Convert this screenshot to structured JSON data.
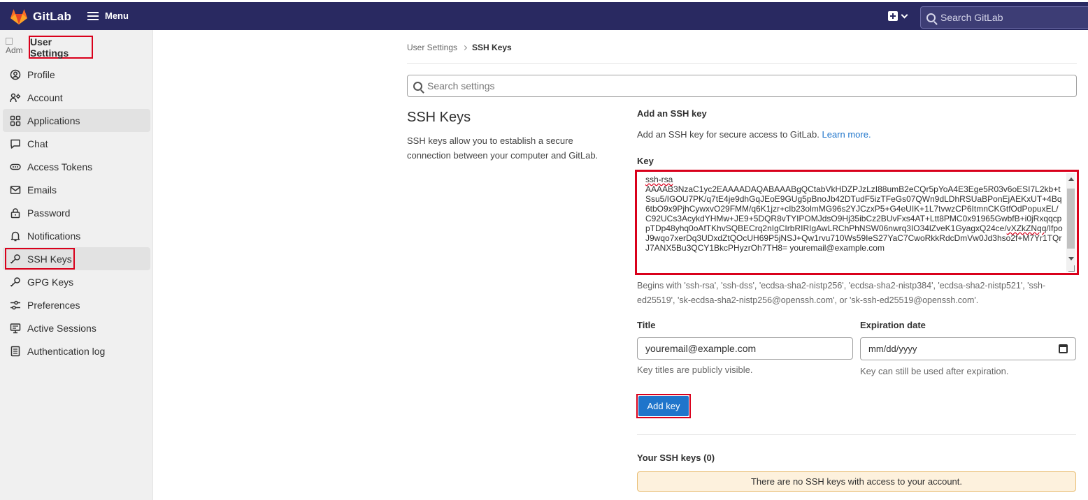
{
  "topbar": {
    "brand": "GitLab",
    "menu_label": "Menu",
    "search_placeholder": "Search GitLab"
  },
  "sidebar": {
    "avatar_alt": "Adm",
    "title": "User Settings",
    "items": [
      {
        "label": "Profile",
        "icon": "profile-icon"
      },
      {
        "label": "Account",
        "icon": "account-icon"
      },
      {
        "label": "Applications",
        "icon": "applications-icon"
      },
      {
        "label": "Chat",
        "icon": "chat-icon"
      },
      {
        "label": "Access Tokens",
        "icon": "access-tokens-icon"
      },
      {
        "label": "Emails",
        "icon": "email-icon"
      },
      {
        "label": "Password",
        "icon": "lock-icon"
      },
      {
        "label": "Notifications",
        "icon": "bell-icon"
      },
      {
        "label": "SSH Keys",
        "icon": "key-icon"
      },
      {
        "label": "GPG Keys",
        "icon": "key-icon"
      },
      {
        "label": "Preferences",
        "icon": "preferences-icon"
      },
      {
        "label": "Active Sessions",
        "icon": "monitor-icon"
      },
      {
        "label": "Authentication log",
        "icon": "log-icon"
      }
    ],
    "active": "SSH Keys"
  },
  "breadcrumb": {
    "parent": "User Settings",
    "current": "SSH Keys"
  },
  "settings_search": {
    "placeholder": "Search settings"
  },
  "section": {
    "title": "SSH Keys",
    "description": "SSH keys allow you to establish a secure connection between your computer and GitLab."
  },
  "form": {
    "heading": "Add an SSH key",
    "intro": "Add an SSH key for secure access to GitLab.",
    "learn_more": "Learn more.",
    "key_label": "Key",
    "key_prefix": "ssh-rsa",
    "key_body_1": "AAAAB3NzaC1yc2EAAAADAQABAAABgQCtabVkHDZPJzLzI88umB2eCQr5pYoA4E3Ege5R03v6oESI7L2kb+tSsu5/IGOU7PK/q7tE4je9dhGqJEoE9GUg5pBnoJb42DTudF5izTFeGs07QWn9dLDhRSUaBPonEjAEKxUT+4Bq6tbO9x9PjhCywxvO29FMM/q6K1jzr+cIb23olmMG96s2YJCzxP5+G4eUIK+1L7tvwzCP6ItmnCKGtfOdPopuxEL/C92UCs3AcykdYHMw+JE9+5DQR8vTYIPOMJdsO9Hj35ibCz2BUvFxs4AT+Ltt8PMC0x91965GwbfB+i0jRxqqcppTDp48yhq0oAfTKhvSQBECrq2nIgCIrbRIRIgAwLRChPhNSW06nwrq3IO34lZveK1GyagxQ24ce/",
    "key_squiggle": "vXZkZNqq",
    "key_body_2": "/IfpoJ9wqo7xerDq3UDxdZtQOcUH69P5jNSJ+Qw1rvu710Ws59IeS27YaC7CwoRkkRdcDmVw0Jd3hso2f+M7Yr1TQrJ7ANX5Bu3QCY1BkcPHyzrOh7TH8= youremail@example.com",
    "key_help": "Begins with 'ssh-rsa', 'ssh-dss', 'ecdsa-sha2-nistp256', 'ecdsa-sha2-nistp384', 'ecdsa-sha2-nistp521', 'ssh-ed25519', 'sk-ecdsa-sha2-nistp256@openssh.com', or 'sk-ssh-ed25519@openssh.com'.",
    "title_label": "Title",
    "title_value": "youremail@example.com",
    "title_help": "Key titles are publicly visible.",
    "expiration_label": "Expiration date",
    "expiration_placeholder": "mm/dd/yyyy",
    "expiration_help": "Key can still be used after expiration.",
    "submit_label": "Add key"
  },
  "keys_list": {
    "heading": "Your SSH keys (0)",
    "empty_message": "There are no SSH keys with access to your account."
  },
  "colors": {
    "topbar": "#292961",
    "highlight": "#d9001b",
    "primary_button": "#1f75cb",
    "alert_bg": "#fdf1dd"
  }
}
